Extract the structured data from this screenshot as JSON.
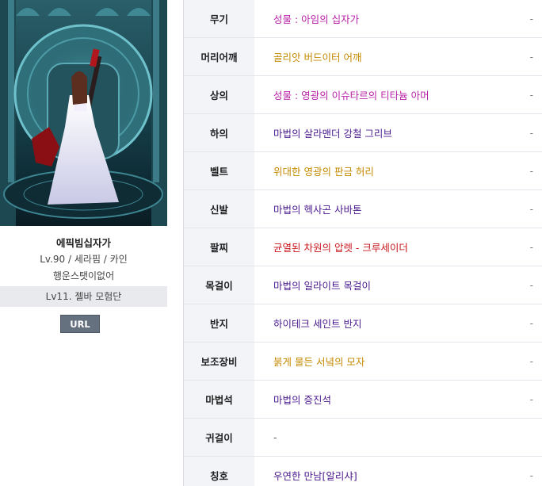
{
  "character": {
    "name": "에픽빔십자가",
    "class_line": "Lv.90 / 세라핌 / 카인",
    "sub_line": "행운스탯이없어",
    "adventure": "Lv11. 젤바 모험단",
    "url_label": "URL"
  },
  "equipment": [
    {
      "slot": "무기",
      "item": "성물 : 아임의 십자가",
      "color": "#b71fa6",
      "note": "-"
    },
    {
      "slot": "머리어깨",
      "item": "골리앗 버드이터 어깨",
      "color": "#c48a00",
      "note": "-"
    },
    {
      "slot": "상의",
      "item": "성물 : 영광의 이슈타르의 티타늄 아머",
      "color": "#b71fa6",
      "note": "-"
    },
    {
      "slot": "하의",
      "item": "마법의 살라맨더 강철 그리브",
      "color": "#4a1a8c",
      "note": "-"
    },
    {
      "slot": "벨트",
      "item": "위대한 영광의 판금 허리",
      "color": "#c48a00",
      "note": "-"
    },
    {
      "slot": "신발",
      "item": "마법의 헥사곤 사바톤",
      "color": "#4a1a8c",
      "note": "-"
    },
    {
      "slot": "팔찌",
      "item": "균열된 차원의 압렛 - 크루세이더",
      "color": "#c8161d",
      "note": "-"
    },
    {
      "slot": "목걸이",
      "item": "마법의 일라이트 목걸이",
      "color": "#4a1a8c",
      "note": "-"
    },
    {
      "slot": "반지",
      "item": "하이테크 세인트 반지",
      "color": "#4a1a8c",
      "note": "-"
    },
    {
      "slot": "보조장비",
      "item": "붉게 물든 서녘의 모자",
      "color": "#c48a00",
      "note": "-"
    },
    {
      "slot": "마법석",
      "item": "마법의 증진석",
      "color": "#4a1a8c",
      "note": "-"
    },
    {
      "slot": "귀걸이",
      "item": "-",
      "color": "#555555",
      "note": ""
    },
    {
      "slot": "칭호",
      "item": "우연한 만남[알리샤]",
      "color": "#4a1a8c",
      "note": "-"
    }
  ]
}
